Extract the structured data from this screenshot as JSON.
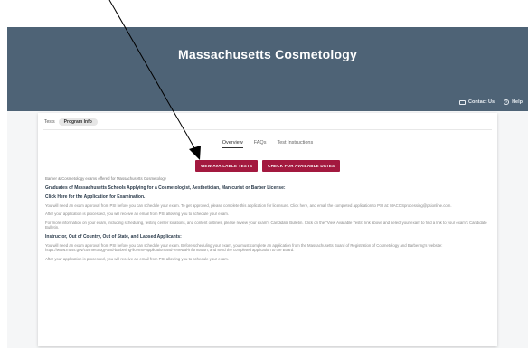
{
  "header": {
    "title": "Massachusetts Cosmetology",
    "contact_label": "Contact Us",
    "help_label": "Help",
    "contact_icon": "card-icon",
    "help_icon": "question-circle-icon"
  },
  "tests": {
    "label": "Tests",
    "chip": "Program Info"
  },
  "tabs": [
    {
      "label": "Overview",
      "active": true
    },
    {
      "label": "FAQs",
      "active": false
    },
    {
      "label": "Test Instructions",
      "active": false
    }
  ],
  "buttons": {
    "view_tests": "VIEW AVAILABLE TESTS",
    "check_dates": "CHECK FOR AVAILABLE DATES"
  },
  "colors": {
    "banner": "#4e6376",
    "button": "#a3193f",
    "annotation_arrow": "#000000"
  },
  "content": {
    "intro": "Barber & Cosmetology exams offered for Massachusetts Cosmetology",
    "graduates_heading": "Graduates of Massachusetts Schools Applying for a Cosmetologist, Aesthetician, Manicurist or Barber License:",
    "click_here": "Click Here for the Application for Examination.",
    "para1": "You will need an exam approval from PSI before you can schedule your exam. To get approved, please complete this application for licensure. Click here, and email the completed application to PSI at: MACOSprocessing@psionline.com.",
    "para2": "After your application is processed, you will receive an email from PSI allowing you to schedule your exam.",
    "para3": "For more information on your exam, including scheduling, testing center locations, and content outlines, please review your exam's Candidate Bulletin. Click on the \"View Available Tests\" link above and select your exam to find a link to your exam's Candidate Bulletin.",
    "instructor_heading": "Instructor, Out of Country, Out of State, and Lapsed Applicants:",
    "para4": "You will need an exam approval from PSI before you can schedule your exam. Before scheduling your exam, you must complete an application from the Massachusetts Board of Registration of Cosmetology and Barbering's website: https://www.mass.gov/cosmetology-and-barbering-license-application-and-renewal-information, and send the completed application to the Board.",
    "para5": "After your application is processed, you will receive an email from PSI allowing you to schedule your exam."
  }
}
